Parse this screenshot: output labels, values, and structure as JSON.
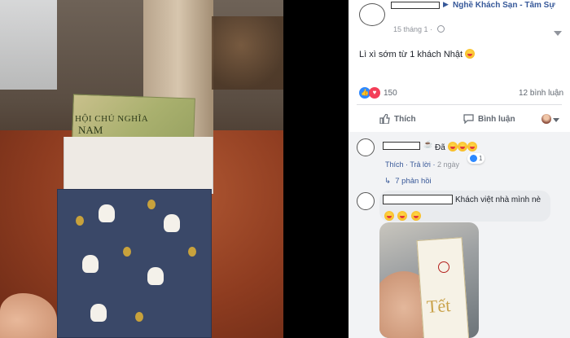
{
  "post": {
    "page_name": "Nghề Khách Sạn - Tâm Sự",
    "date": "15 tháng 1",
    "text": "Lì xì sớm từ 1 khách Nhật",
    "reaction_count": "150",
    "comment_count": "12 bình luận"
  },
  "actions": {
    "like": "Thích",
    "comment": "Bình luận"
  },
  "comments": [
    {
      "text": "Đã",
      "reply_like": "Thích",
      "reply": "Trả lời",
      "time": "2 ngày",
      "like_count": "1",
      "replies_link": "7 phản hồi"
    },
    {
      "text_line1": "Khách việt nhà mình nè"
    }
  ],
  "photo": {
    "banknote_line1": "HỘI CHỦ NGHĨA",
    "banknote_line2": "NAM"
  },
  "thumbnail": {
    "script": "Tết"
  },
  "colors": {
    "link": "#365899",
    "like_blue": "#2d88ff",
    "love_red": "#f33e58"
  },
  "icons": [
    "globe-icon",
    "dropdown-caret-icon",
    "like-icon",
    "comment-icon",
    "avatar-selector-icon",
    "emoji-icon",
    "like-reaction-icon",
    "love-reaction-icon",
    "reply-arrow-icon"
  ]
}
